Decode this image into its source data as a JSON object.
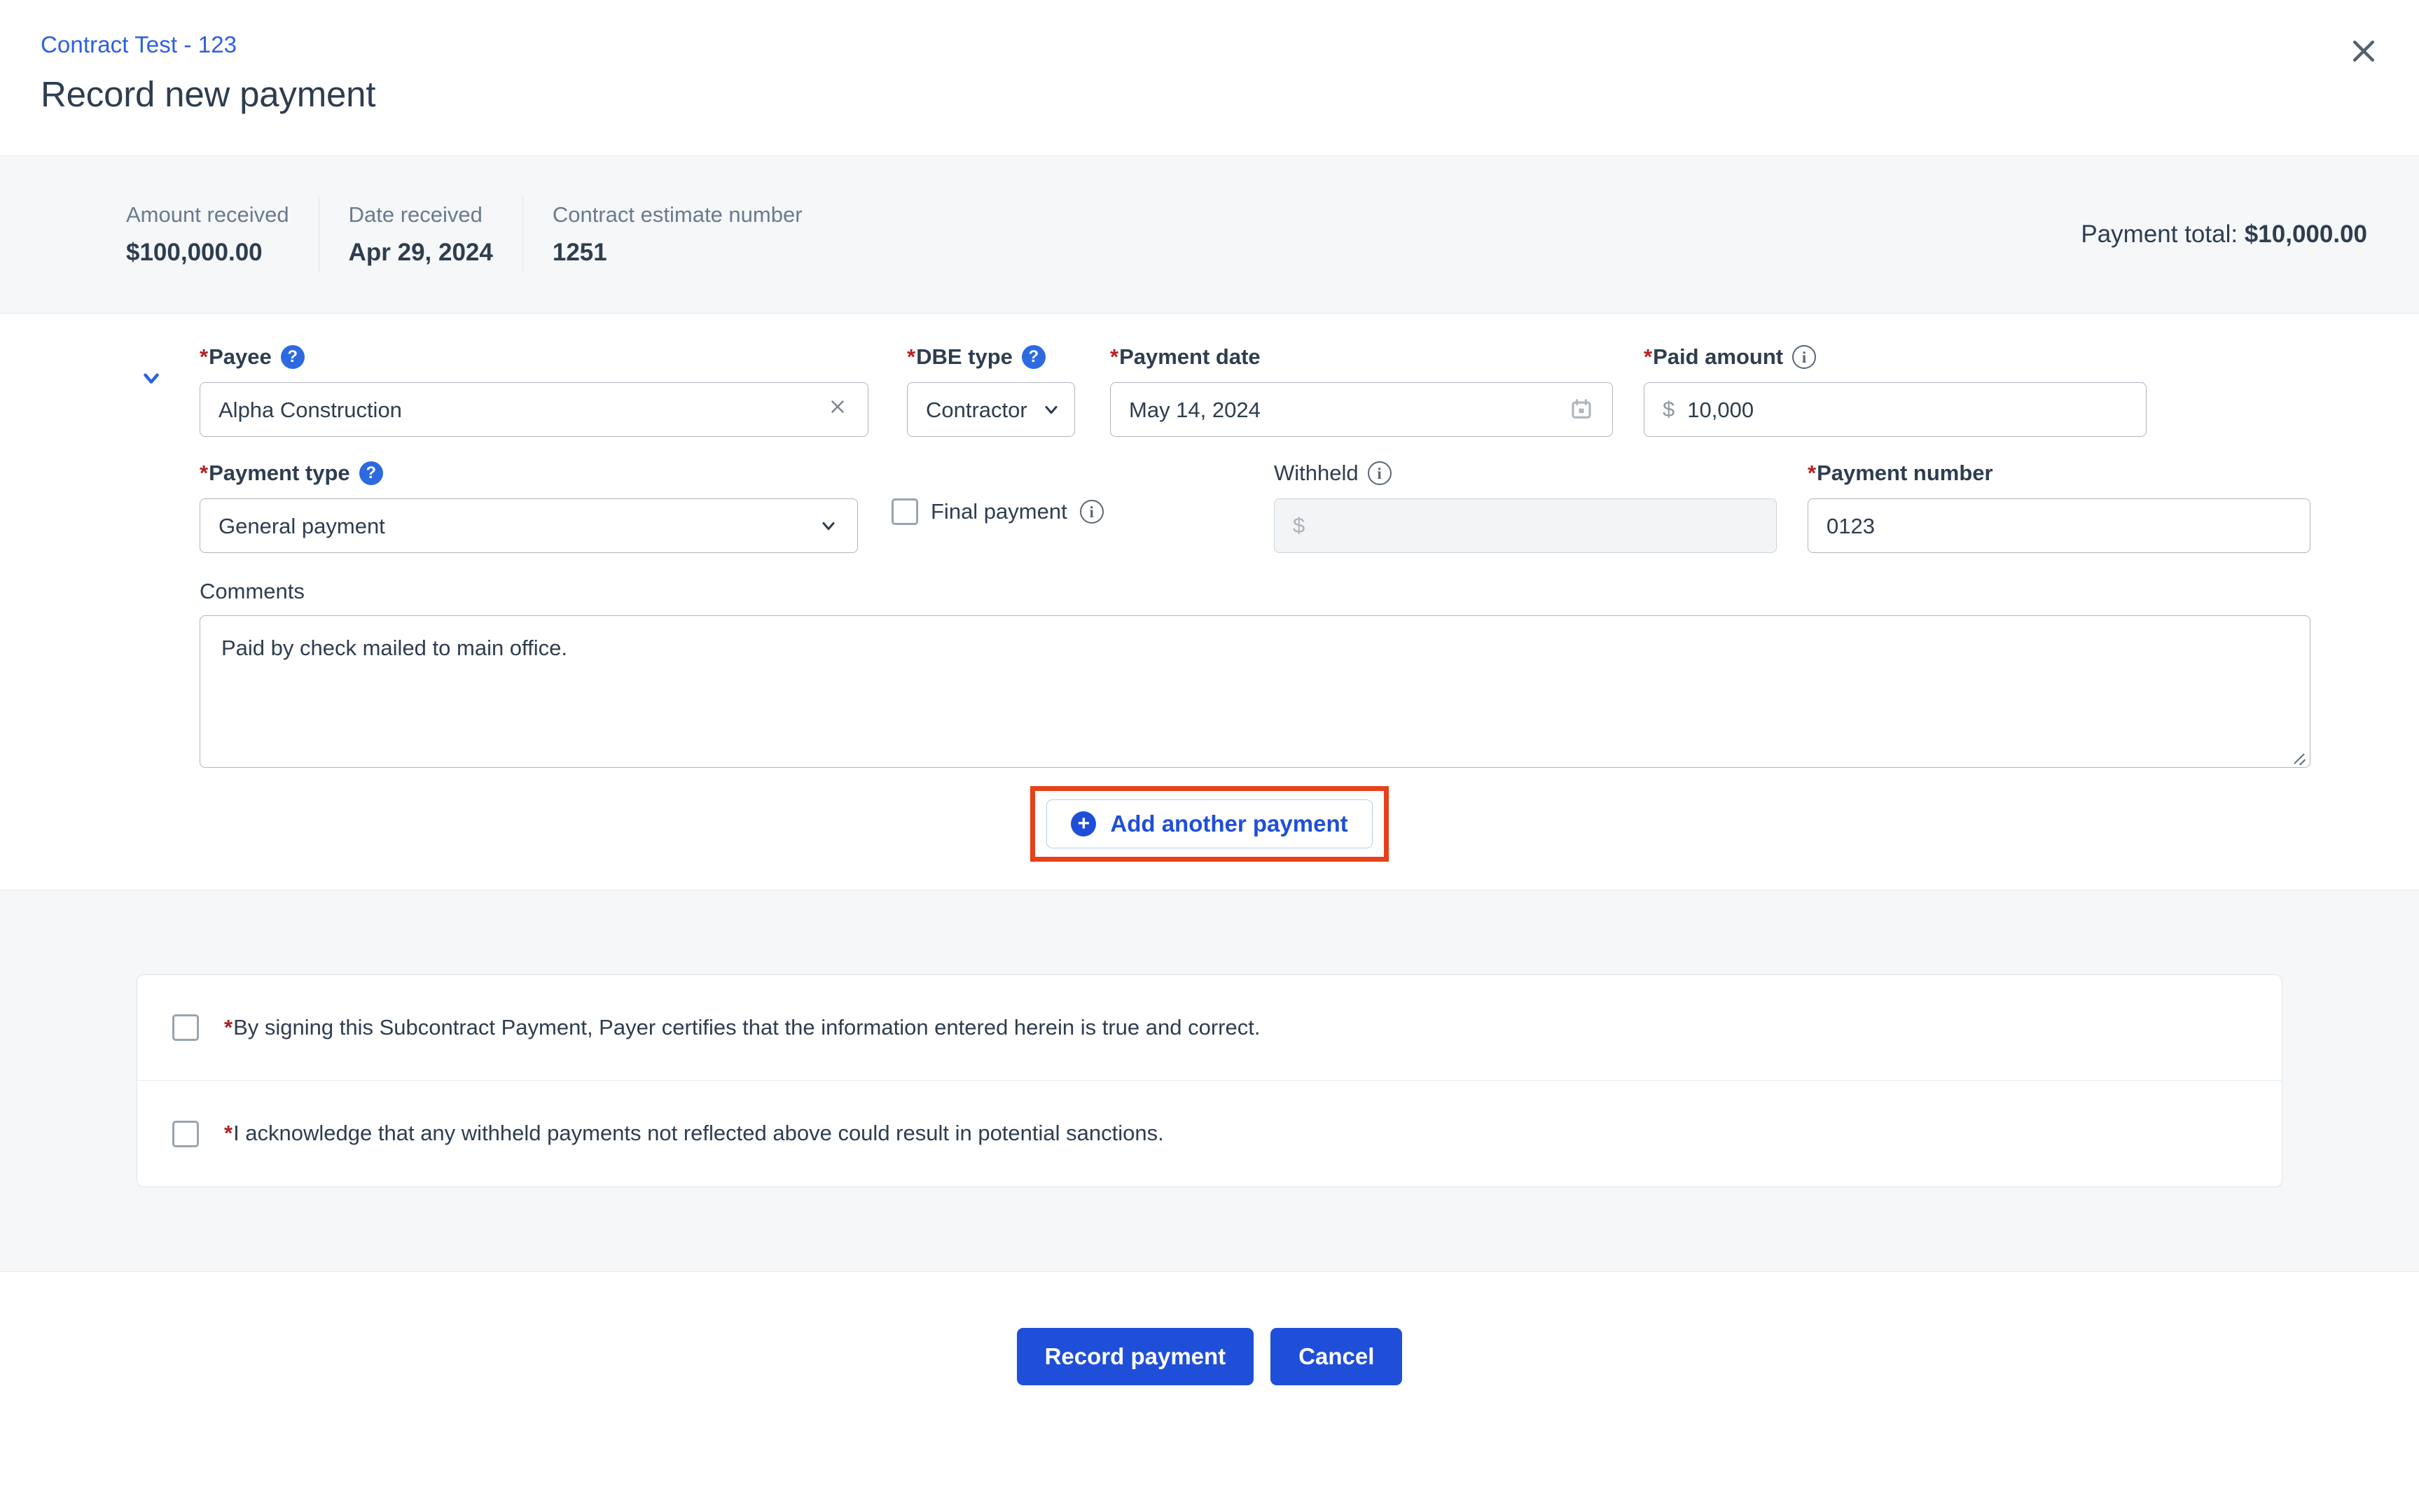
{
  "header": {
    "breadcrumb": "Contract Test - 123",
    "title": "Record new payment",
    "close_icon": "close-icon"
  },
  "summary": {
    "items": [
      {
        "label": "Amount received",
        "value": "$100,000.00"
      },
      {
        "label": "Date received",
        "value": "Apr 29, 2024"
      },
      {
        "label": "Contract estimate number",
        "value": "1251"
      }
    ],
    "total_label": "Payment total:",
    "total_value": "$10,000.00"
  },
  "form": {
    "collapse_icon": "chevron-down-icon",
    "payee": {
      "label": "Payee",
      "required_marker": "*",
      "help_icon": "question-mark-icon",
      "value": "Alpha Construction",
      "clear_icon": "close-icon"
    },
    "dbe_type": {
      "label": "DBE type",
      "required_marker": "*",
      "help_icon": "question-mark-icon",
      "value": "Contractor",
      "dropdown_icon": "chevron-down-icon"
    },
    "payment_date": {
      "label": "Payment date",
      "required_marker": "*",
      "value": "May 14, 2024",
      "calendar_icon": "calendar-icon"
    },
    "paid_amount": {
      "label": "Paid amount",
      "required_marker": "*",
      "info_icon": "info-icon",
      "prefix": "$",
      "value": "10,000"
    },
    "payment_type": {
      "label": "Payment type",
      "required_marker": "*",
      "help_icon": "question-mark-icon",
      "value": "General payment",
      "dropdown_icon": "chevron-down-icon"
    },
    "final_payment": {
      "label": "Final payment",
      "checked": false,
      "info_icon": "info-icon"
    },
    "withheld": {
      "label": "Withheld",
      "info_icon": "info-icon",
      "placeholder": "$",
      "value": "",
      "disabled": true
    },
    "payment_number": {
      "label": "Payment number",
      "required_marker": "*",
      "value": "0123"
    },
    "comments": {
      "label": "Comments",
      "value": "Paid by check mailed to main office."
    },
    "add_another": {
      "label": "Add another payment",
      "plus_icon": "plus-circle-icon",
      "highlighted": true,
      "highlight_color": "#e8401a"
    }
  },
  "certifications": [
    {
      "required_marker": "*",
      "text": "By signing this Subcontract Payment, Payer certifies that the information entered herein is true and correct.",
      "checked": false
    },
    {
      "required_marker": "*",
      "text": "I acknowledge that any withheld payments not reflected above could result in potential sanctions.",
      "checked": false
    }
  ],
  "footer": {
    "submit_label": "Record payment",
    "cancel_label": "Cancel"
  },
  "colors": {
    "accent": "#1f4fd8",
    "link": "#2d5fe3",
    "required": "#b32020",
    "highlight": "#e8401a",
    "panel_bg": "#f5f7f9",
    "text": "#2e3d4f"
  }
}
